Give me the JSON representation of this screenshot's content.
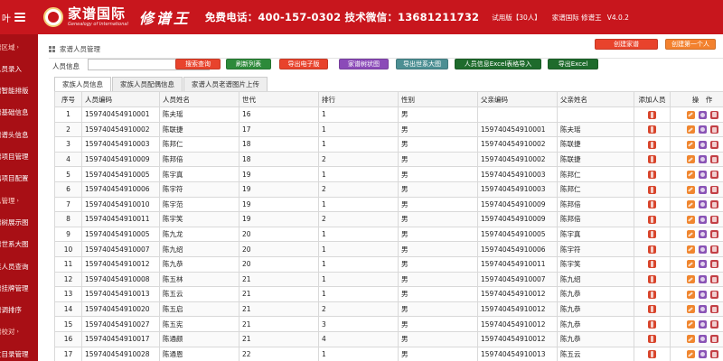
{
  "header": {
    "left_fragment": "叶",
    "logo_cn": "家谱国际",
    "logo_en": "Genealogy of International",
    "product_name": "修谱王",
    "contact": "免费电话：400-157-0302 技术微信：13681211732",
    "trial": "试用版【30人】",
    "product": "家谱国际 修谱王",
    "version": "V4.0.2",
    "brand_color": "#c8161d"
  },
  "sidebar": {
    "items": [
      {
        "label": "谱区域",
        "arrow": "›",
        "section": true
      },
      {
        "label": "人员录入"
      },
      {
        "label": "谱智能排版"
      },
      {
        "label": "谱基础信息"
      },
      {
        "label": "谱谱头信息"
      },
      {
        "label": "谱项目管理"
      },
      {
        "label": "出项目配置"
      },
      {
        "label": "息管理",
        "arrow": "›",
        "section": true
      },
      {
        "label": "谱树展示图"
      },
      {
        "label": "谱世系大图"
      },
      {
        "label": "族人员查询"
      },
      {
        "label": "谱挂牌管理"
      },
      {
        "label": "谱调排序"
      },
      {
        "label": "谱校对",
        "arrow": "›",
        "section": true
      },
      {
        "label": "世目录管理"
      }
    ]
  },
  "main": {
    "breadcrumb": "家谱人员管理",
    "buttons": {
      "create_genealogy": "创建家谱",
      "create_first_person": "创建第一个人",
      "search": "搜索查询",
      "refresh": "刷新列表",
      "export_ebook": "导出电子版",
      "genealogy_tree": "家谱树状图",
      "export_lineage_chart": "导出世系大图",
      "import_excel": "人员信息Excel表格导入",
      "export_excel": "导出Excel"
    },
    "search": {
      "label": "人员信息",
      "value": "",
      "placeholder": ""
    },
    "tabs": [
      {
        "label": "家族人员信息",
        "active": true
      },
      {
        "label": "家族人员配偶信息"
      },
      {
        "label": "家谱人员老谱图片上传"
      }
    ]
  },
  "table": {
    "headers": [
      "序号",
      "人员编码",
      "人员姓名",
      "世代",
      "排行",
      "性别",
      "父亲编码",
      "父亲姓名",
      "添加人员",
      "操　作"
    ],
    "rows": [
      [
        "1",
        "159740454910001",
        "陈夫瑶",
        "16",
        "1",
        "男",
        "",
        ""
      ],
      [
        "2",
        "159740454910002",
        "陈联捷",
        "17",
        "1",
        "男",
        "159740454910001",
        "陈夫瑶"
      ],
      [
        "3",
        "159740454910003",
        "陈邦仁",
        "18",
        "1",
        "男",
        "159740454910002",
        "陈联捷"
      ],
      [
        "4",
        "159740454910009",
        "陈邦倍",
        "18",
        "2",
        "男",
        "159740454910002",
        "陈联捷"
      ],
      [
        "5",
        "159740454910005",
        "陈宇真",
        "19",
        "1",
        "男",
        "159740454910003",
        "陈邦仁"
      ],
      [
        "6",
        "159740454910006",
        "陈宇符",
        "19",
        "2",
        "男",
        "159740454910003",
        "陈邦仁"
      ],
      [
        "7",
        "159740454910010",
        "陈宇范",
        "19",
        "1",
        "男",
        "159740454910009",
        "陈邦倍"
      ],
      [
        "8",
        "159740454910011",
        "陈宇笑",
        "19",
        "2",
        "男",
        "159740454910009",
        "陈邦倍"
      ],
      [
        "9",
        "159740454910005",
        "陈九龙",
        "20",
        "1",
        "男",
        "159740454910005",
        "陈宇真"
      ],
      [
        "10",
        "159740454910007",
        "陈九绍",
        "20",
        "1",
        "男",
        "159740454910006",
        "陈宇符"
      ],
      [
        "11",
        "159740454910012",
        "陈九恭",
        "20",
        "1",
        "男",
        "159740454910011",
        "陈宇笑"
      ],
      [
        "12",
        "159740454910008",
        "陈五林",
        "21",
        "1",
        "男",
        "159740454910007",
        "陈九绍"
      ],
      [
        "13",
        "159740454910013",
        "陈五云",
        "21",
        "1",
        "男",
        "159740454910012",
        "陈九恭"
      ],
      [
        "14",
        "159740454910020",
        "陈五启",
        "21",
        "2",
        "男",
        "159740454910012",
        "陈九恭"
      ],
      [
        "15",
        "159740454910027",
        "陈五宪",
        "21",
        "3",
        "男",
        "159740454910012",
        "陈九恭"
      ],
      [
        "16",
        "159740454910017",
        "陈通颜",
        "21",
        "4",
        "男",
        "159740454910012",
        "陈九恭"
      ],
      [
        "17",
        "159740454910028",
        "陈通恩",
        "22",
        "1",
        "男",
        "159740454910013",
        "陈五云"
      ]
    ]
  }
}
